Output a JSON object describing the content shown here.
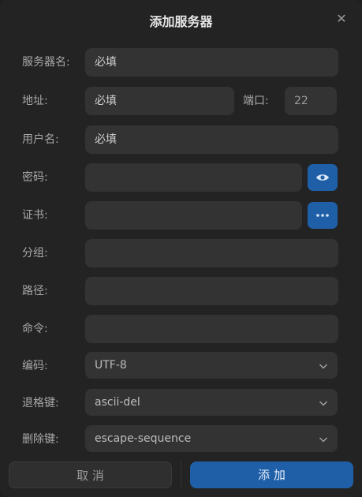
{
  "dialog": {
    "title": "添加服务器",
    "close_icon": "close-icon"
  },
  "fields": {
    "server_name": {
      "label": "服务器名:",
      "placeholder": "必填"
    },
    "address": {
      "label": "地址:",
      "placeholder": "必填"
    },
    "port": {
      "label": "端口:",
      "value": "22"
    },
    "username": {
      "label": "用户名:",
      "placeholder": "必填"
    },
    "password": {
      "label": "密码:",
      "value": "",
      "toggle_icon": "eye-icon"
    },
    "certificate": {
      "label": "证书:",
      "value": "",
      "browse_icon": "more-dots-icon"
    },
    "group": {
      "label": "分组:",
      "value": ""
    },
    "path": {
      "label": "路径:",
      "value": ""
    },
    "command": {
      "label": "命令:",
      "value": ""
    },
    "encoding": {
      "label": "编码:",
      "value": "UTF-8"
    },
    "backspace_key": {
      "label": "退格键:",
      "value": "ascii-del"
    },
    "delete_key": {
      "label": "删除键:",
      "value": "escape-sequence"
    }
  },
  "buttons": {
    "cancel": "取 消",
    "add": "添 加"
  },
  "colors": {
    "accent": "#1f5fa8",
    "field_bg": "#333333",
    "dialog_bg": "#232323"
  }
}
